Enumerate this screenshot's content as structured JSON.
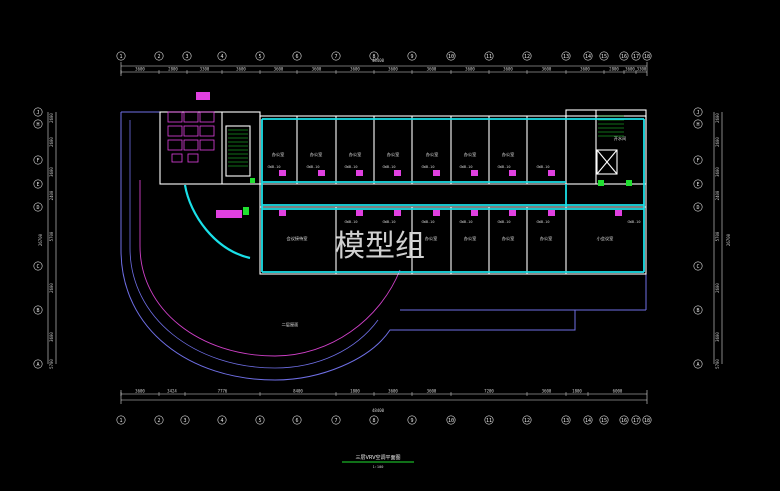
{
  "colors": {
    "background": "#000000",
    "wall": "#ffffff",
    "duct": "#1ae0e8",
    "curve_outer": "#6f6fe6",
    "curve_inner": "#d040c8",
    "unit": "#e040e0",
    "green": "#20e030",
    "dim_line": "#e0e0e0"
  },
  "grid_top": [
    "1",
    "2",
    "3",
    "4",
    "5",
    "6",
    "7",
    "8",
    "9",
    "10",
    "11",
    "12",
    "13",
    "14",
    "15",
    "16",
    "17",
    "18"
  ],
  "grid_bottom": [
    "1",
    "2",
    "3",
    "4",
    "5",
    "6",
    "7",
    "8",
    "9",
    "10",
    "11",
    "12",
    "13",
    "14",
    "15",
    "16",
    "17",
    "18"
  ],
  "grid_left": [
    "J",
    "H",
    "F",
    "E",
    "D",
    "C",
    "B",
    "A"
  ],
  "grid_right": [
    "J",
    "H",
    "F",
    "E",
    "D",
    "C",
    "B",
    "A"
  ],
  "dims_top_segments": [
    "3600",
    "2800",
    "3300",
    "3600",
    "3600",
    "3600",
    "3600",
    "3600",
    "3600",
    "3600",
    "3600",
    "3600",
    "3600",
    "2800",
    "3600",
    "3300"
  ],
  "dim_top_total": "48400",
  "dims_bottom_segments": [
    "3600",
    "3424",
    "7776",
    "8400",
    "1800",
    "3600",
    "3600",
    "7200",
    "3600",
    "1800",
    "6000"
  ],
  "dim_bottom_total": "48400",
  "dims_left": [
    "2600",
    "2600",
    "3600",
    "2400",
    "5700",
    "2600",
    "3600",
    "5700"
  ],
  "dim_left_total": "26700",
  "dims_right": [
    "2600",
    "2600",
    "3600",
    "2400",
    "5700",
    "2600",
    "3600",
    "5700"
  ],
  "dim_right_total": "26700",
  "rooms_upper": [
    "办公室",
    "办公室",
    "办公室",
    "办公室",
    "办公室",
    "办公室",
    "办公室"
  ],
  "rooms_lower": [
    "会议接待室",
    "办公室",
    "办公室",
    "办公室",
    "办公室",
    "小会议室"
  ],
  "label_stair_corner": "开水间",
  "label_roof": "二层屋面",
  "label_upper_tag": "GWB-10",
  "label_lower_tag": "GWB-10",
  "watermark": "模型组",
  "drawing_title": "三层VRV空调平面图",
  "drawing_scale": "1:100"
}
